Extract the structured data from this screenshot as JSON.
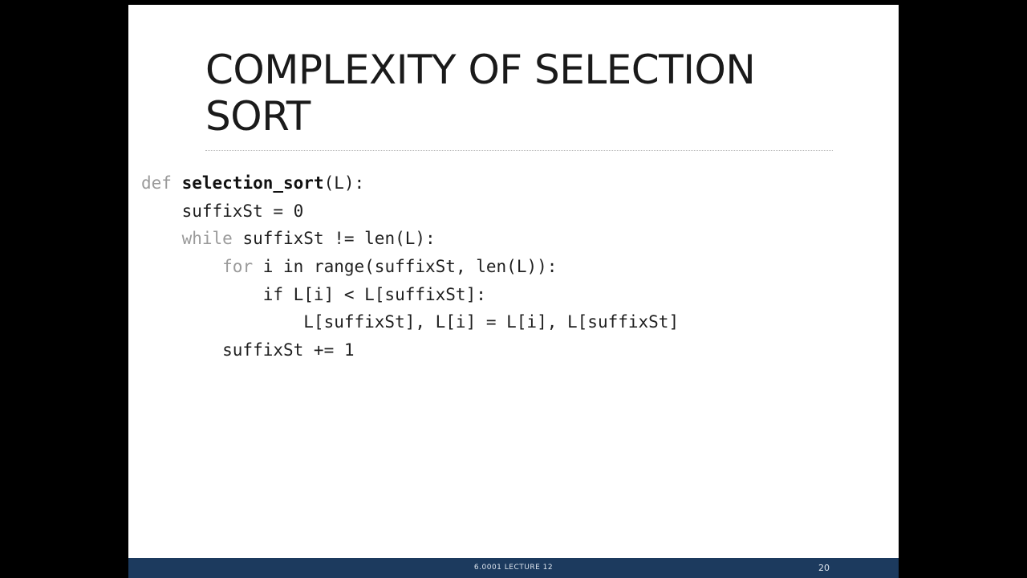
{
  "slide": {
    "title_line1": "COMPLEXITY OF SELECTION",
    "title_line2": "SORT",
    "code": {
      "line1": {
        "kw": "def",
        "fn": "selection_sort",
        "rest": "(L):"
      },
      "line2": {
        "text": "    suffixSt = 0"
      },
      "line3": {
        "indent": "    ",
        "kw": "while",
        "rest": " suffixSt != len(L):"
      },
      "line4": {
        "indent": "        ",
        "kw": "for",
        "rest": " i in range(suffixSt, len(L)):"
      },
      "line5": {
        "text": "            if L[i] < L[suffixSt]:"
      },
      "line6": {
        "text": "                L[suffixSt], L[i] = L[i], L[suffixSt]"
      },
      "line7": {
        "text": "        suffixSt += 1"
      }
    },
    "footer": {
      "label": "6.0001 LECTURE 12",
      "page_number": "20"
    }
  },
  "colors": {
    "footer_bar": "#1c3a5e",
    "background": "#000000",
    "slide": "#ffffff",
    "keyword": "#9a9a9a"
  }
}
